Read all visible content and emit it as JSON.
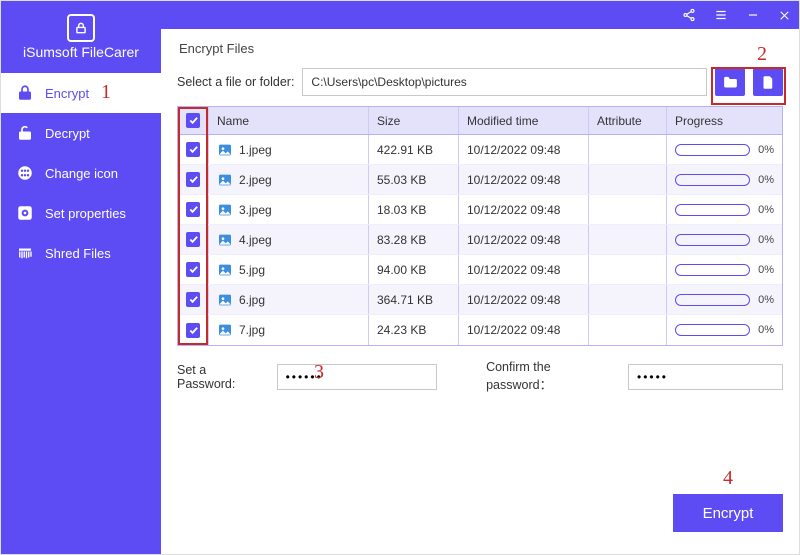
{
  "brand": "iSumsoft FileCarer",
  "sidebar": {
    "items": [
      {
        "label": "Encrypt",
        "icon": "lock-icon"
      },
      {
        "label": "Decrypt",
        "icon": "unlock-icon"
      },
      {
        "label": "Change icon",
        "icon": "grid-icon"
      },
      {
        "label": "Set properties",
        "icon": "gear-icon"
      },
      {
        "label": "Shred Files",
        "icon": "shred-icon"
      }
    ]
  },
  "titlebar": {
    "share": "share",
    "menu": "menu",
    "min": "minimize",
    "close": "close"
  },
  "panel": {
    "title": "Encrypt Files",
    "select_label": "Select a file or folder:",
    "path": "C:\\Users\\pc\\Desktop\\pictures"
  },
  "columns": {
    "name": "Name",
    "size": "Size",
    "modified": "Modified time",
    "attribute": "Attribute",
    "progress": "Progress"
  },
  "files": [
    {
      "checked": true,
      "name": "1.jpeg",
      "size": "422.91 KB",
      "modified": "10/12/2022 09:48",
      "attribute": "",
      "progress": "0%"
    },
    {
      "checked": true,
      "name": "2.jpeg",
      "size": "55.03 KB",
      "modified": "10/12/2022 09:48",
      "attribute": "",
      "progress": "0%"
    },
    {
      "checked": true,
      "name": "3.jpeg",
      "size": "18.03 KB",
      "modified": "10/12/2022 09:48",
      "attribute": "",
      "progress": "0%"
    },
    {
      "checked": true,
      "name": "4.jpeg",
      "size": "83.28 KB",
      "modified": "10/12/2022 09:48",
      "attribute": "",
      "progress": "0%"
    },
    {
      "checked": true,
      "name": "5.jpg",
      "size": "94.00 KB",
      "modified": "10/12/2022 09:48",
      "attribute": "",
      "progress": "0%"
    },
    {
      "checked": true,
      "name": "6.jpg",
      "size": "364.71 KB",
      "modified": "10/12/2022 09:48",
      "attribute": "",
      "progress": "0%"
    },
    {
      "checked": true,
      "name": "7.jpg",
      "size": "24.23 KB",
      "modified": "10/12/2022 09:48",
      "attribute": "",
      "progress": "0%"
    }
  ],
  "password": {
    "set_label": "Set a Password:",
    "confirm_label": "Confirm the password：",
    "set_value": "••••••",
    "confirm_value": "•••••"
  },
  "action": {
    "encrypt": "Encrypt"
  },
  "annotations": {
    "a1": "1",
    "a2": "2",
    "a3": "3",
    "a4": "4"
  }
}
